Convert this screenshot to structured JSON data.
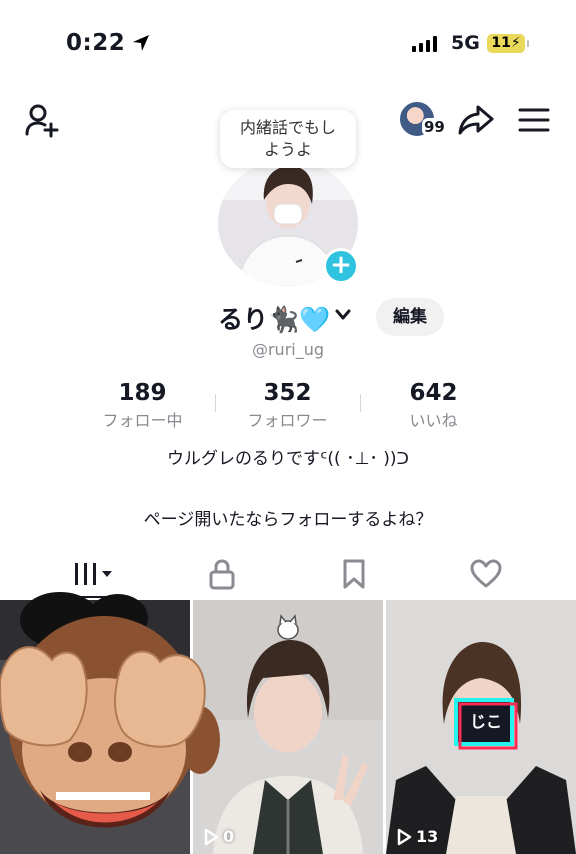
{
  "status_bar": {
    "time": "0:22",
    "network": "5G",
    "battery": "11"
  },
  "top_nav": {
    "friend_count": "99"
  },
  "bubble": {
    "line1": "内緒話でもし",
    "line2": "ようよ"
  },
  "profile": {
    "nickname": "るり🐈‍⬛🩵",
    "username": "@ruri_ug",
    "edit_label": "編集",
    "stats": [
      {
        "value": "189",
        "label": "フォロー中"
      },
      {
        "value": "352",
        "label": "フォロワー"
      },
      {
        "value": "642",
        "label": "いいね"
      }
    ],
    "bio_line1": "ウルグレのるりですᑦ(( ･⊥･ ))ᑐ",
    "bio_line2": "ページ開いたならフォローするよね？"
  },
  "videos": [
    {
      "views": ""
    },
    {
      "views": "0"
    },
    {
      "views": "13",
      "sticker": "じこ"
    }
  ],
  "colors": {
    "accent": "#2fc3e0",
    "text": "#161823",
    "muted": "#8a8b91"
  }
}
